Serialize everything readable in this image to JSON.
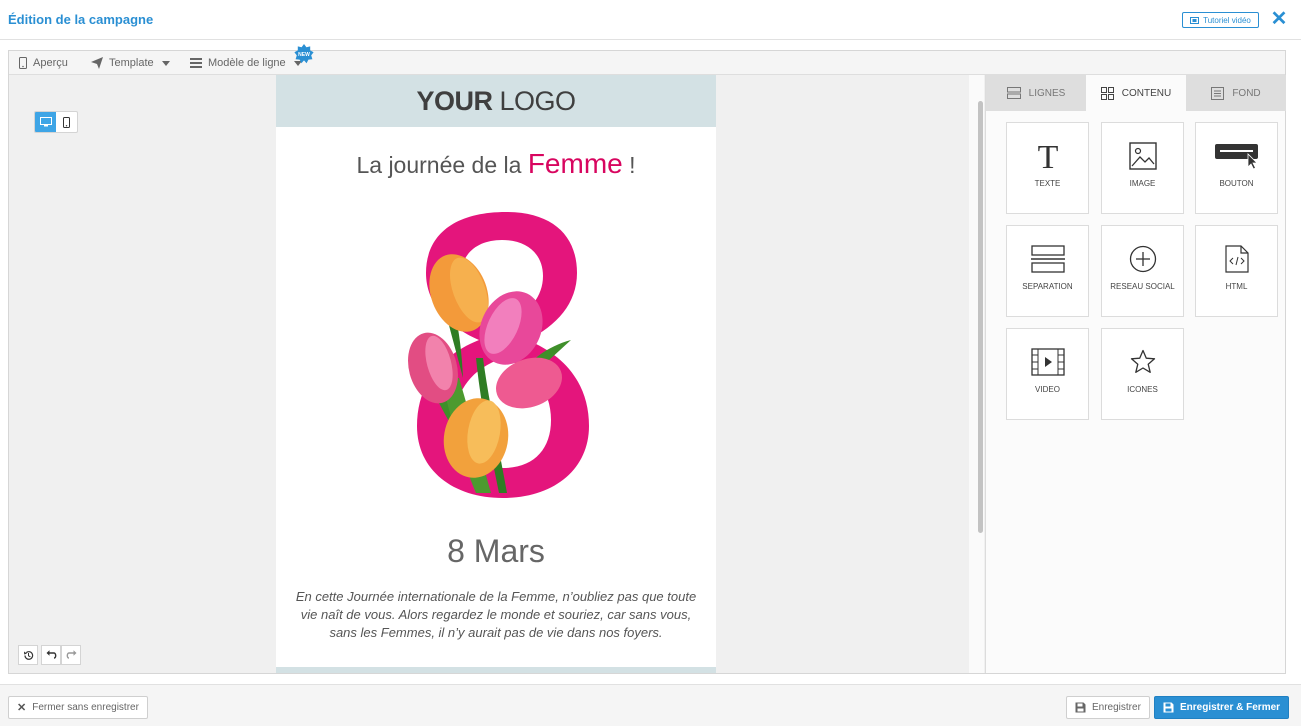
{
  "header": {
    "title": "Édition de la campagne",
    "tutorial_label": "Tutoriel vidéo"
  },
  "toolbar": {
    "preview_label": "Aperçu",
    "template_label": "Template",
    "row_model_label": "Modèle de ligne",
    "new_badge": "NEW"
  },
  "email": {
    "logo_bold": "YOUR",
    "logo_light": "LOGO",
    "headline_prefix": "La journée de la",
    "headline_accent": "Femme",
    "headline_suffix": "!",
    "date": "8 Mars",
    "paragraph": "En cette Journée internationale de la Femme, n’oubliez pas que toute vie naît de vous. Alors regardez le monde et souriez, car sans vous, sans les Femmes, il n’y aurait pas de vie dans nos foyers."
  },
  "panel": {
    "tabs": [
      {
        "label": "LIGNES",
        "icon": "rows-icon"
      },
      {
        "label": "CONTENU",
        "icon": "grid-icon"
      },
      {
        "label": "FOND",
        "icon": "background-icon"
      }
    ],
    "active_tab": "CONTENU",
    "blocks": [
      {
        "label": "TEXTE",
        "icon": "text-icon"
      },
      {
        "label": "IMAGE",
        "icon": "image-icon"
      },
      {
        "label": "BOUTON",
        "icon": "button-icon"
      },
      {
        "label": "SEPARATION",
        "icon": "separator-icon"
      },
      {
        "label": "RESEAU SOCIAL",
        "icon": "social-icon"
      },
      {
        "label": "HTML",
        "icon": "html-icon"
      },
      {
        "label": "VIDEO",
        "icon": "video-icon"
      },
      {
        "label": "ICONES",
        "icon": "star-icon"
      }
    ]
  },
  "footer": {
    "close_no_save": "Fermer sans enregistrer",
    "save": "Enregistrer",
    "save_close": "Enregistrer & Fermer"
  },
  "colors": {
    "accent": "#2a8fd3",
    "brand_pink": "#d8055f",
    "logo_band": "#d3e1e4"
  }
}
